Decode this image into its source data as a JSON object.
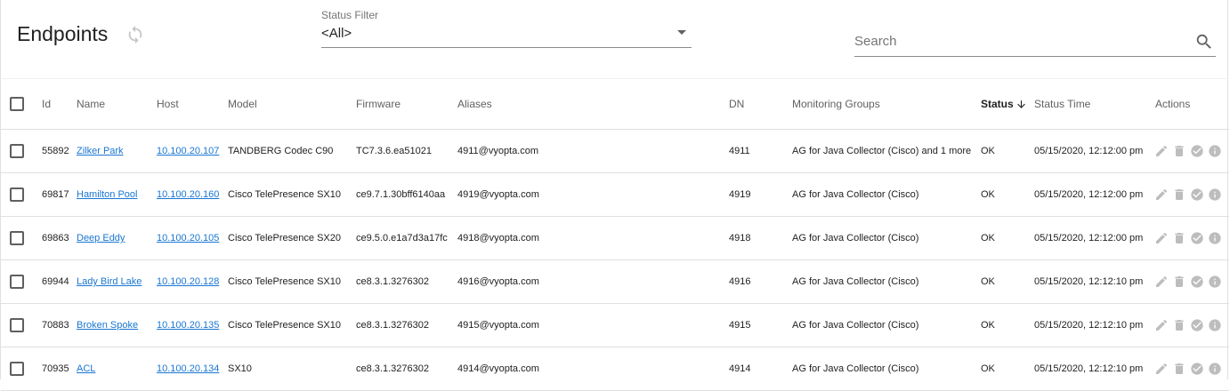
{
  "page": {
    "title": "Endpoints"
  },
  "icons": {
    "refresh": "refresh-icon",
    "caret": "dropdown-caret-icon",
    "search": "search-icon",
    "sort": "arrow-down-icon",
    "edit": "pencil-icon",
    "delete": "trash-icon",
    "check": "check-circle-icon",
    "info": "info-icon"
  },
  "colors": {
    "link": "#1976d2",
    "icon_grey": "#bdbdbd",
    "divider": "#e0e0e0"
  },
  "status_filter": {
    "label": "Status Filter",
    "value": "<All>"
  },
  "search": {
    "placeholder": "Search",
    "value": ""
  },
  "table": {
    "columns": {
      "id": "Id",
      "name": "Name",
      "host": "Host",
      "model": "Model",
      "firmware": "Firmware",
      "aliases": "Aliases",
      "dn": "DN",
      "monitoring_groups": "Monitoring Groups",
      "status": "Status",
      "status_time": "Status Time",
      "actions": "Actions"
    },
    "sorted_by": "status",
    "sort_direction": "descending",
    "rows": [
      {
        "id": "55892",
        "name": "Zilker Park",
        "host": "10.100.20.107",
        "model": "TANDBERG Codec C90",
        "firmware": "TC7.3.6.ea51021",
        "aliases": "4911@vyopta.com",
        "dn": "4911",
        "groups": "AG for Java Collector (Cisco) and 1 more",
        "status": "OK",
        "status_time": "05/15/2020, 12:12:00 pm"
      },
      {
        "id": "69817",
        "name": "Hamilton Pool",
        "host": "10.100.20.160",
        "model": "Cisco TelePresence SX10",
        "firmware": "ce9.7.1.30bff6140aa",
        "aliases": "4919@vyopta.com",
        "dn": "4919",
        "groups": "AG for Java Collector (Cisco)",
        "status": "OK",
        "status_time": "05/15/2020, 12:12:00 pm"
      },
      {
        "id": "69863",
        "name": "Deep Eddy",
        "host": "10.100.20.105",
        "model": "Cisco TelePresence SX20",
        "firmware": "ce9.5.0.e1a7d3a17fc",
        "aliases": "4918@vyopta.com",
        "dn": "4918",
        "groups": "AG for Java Collector (Cisco)",
        "status": "OK",
        "status_time": "05/15/2020, 12:12:00 pm"
      },
      {
        "id": "69944",
        "name": "Lady Bird Lake",
        "host": "10.100.20.128",
        "model": "Cisco TelePresence SX10",
        "firmware": "ce8.3.1.3276302",
        "aliases": "4916@vyopta.com",
        "dn": "4916",
        "groups": "AG for Java Collector (Cisco)",
        "status": "OK",
        "status_time": "05/15/2020, 12:12:10 pm"
      },
      {
        "id": "70883",
        "name": "Broken Spoke",
        "host": "10.100.20.135",
        "model": "Cisco TelePresence SX10",
        "firmware": "ce8.3.1.3276302",
        "aliases": "4915@vyopta.com",
        "dn": "4915",
        "groups": "AG for Java Collector (Cisco)",
        "status": "OK",
        "status_time": "05/15/2020, 12:12:10 pm"
      },
      {
        "id": "70935",
        "name": "ACL",
        "host": "10.100.20.134",
        "model": "SX10",
        "firmware": "ce8.3.1.3276302",
        "aliases": "4914@vyopta.com",
        "dn": "4914",
        "groups": "AG for Java Collector (Cisco)",
        "status": "OK",
        "status_time": "05/15/2020, 12:12:10 pm"
      }
    ]
  }
}
